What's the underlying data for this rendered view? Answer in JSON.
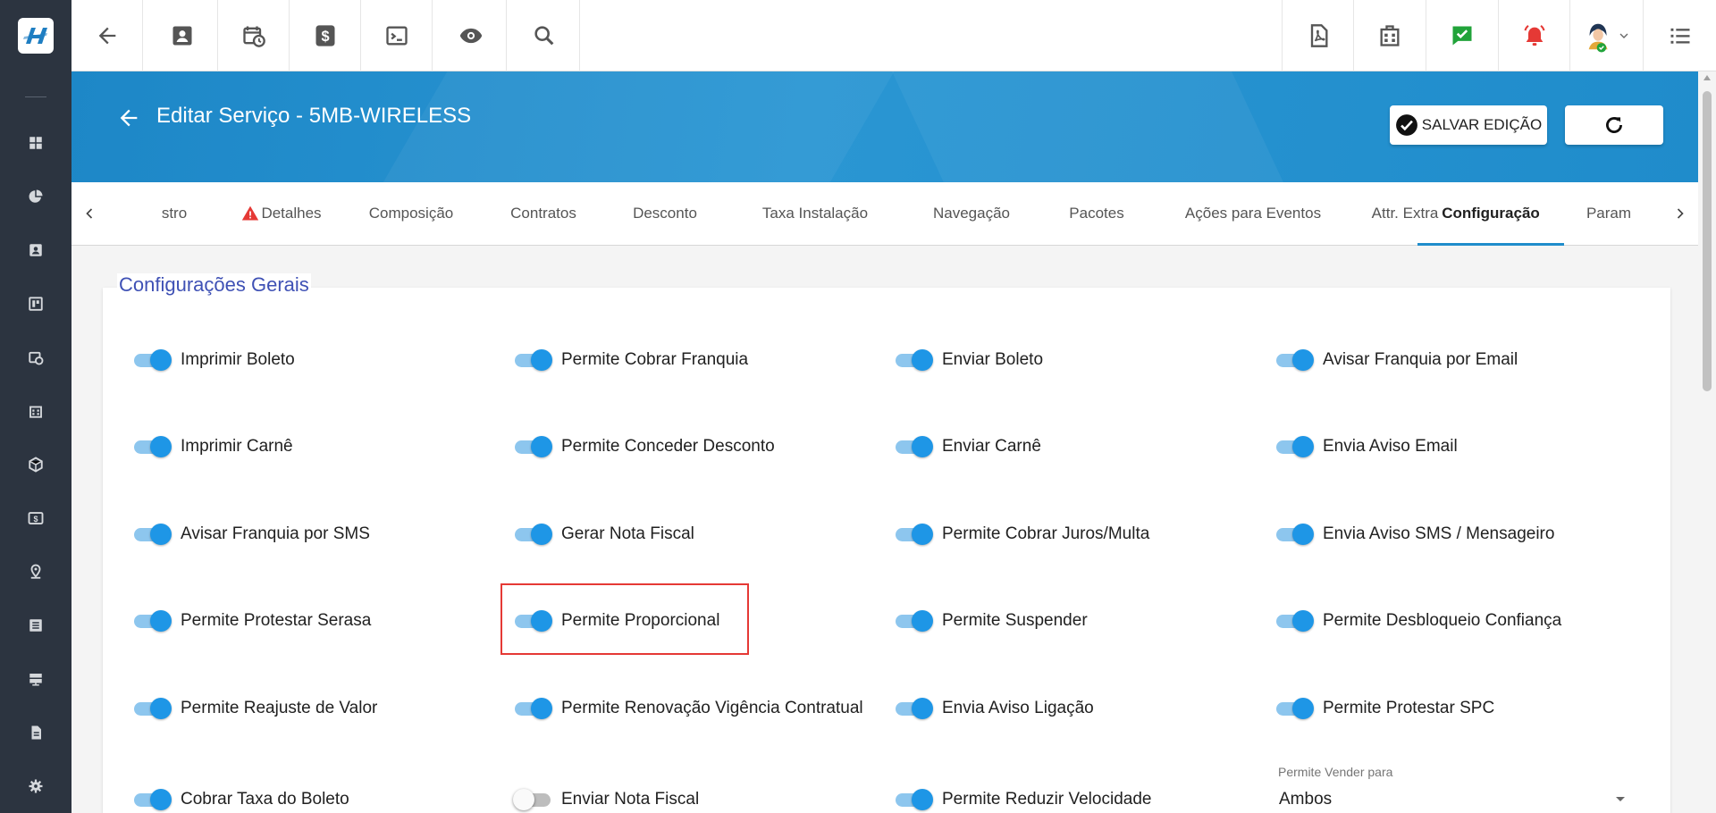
{
  "page": {
    "title": "Editar Serviço - 5MB-WIRELESS",
    "save_label": "SALVAR EDIÇÃO"
  },
  "colors": {
    "banner": "#1f8ccb",
    "sidebar": "#2c3440",
    "toggle_on": "#1e96e6",
    "section_title": "#3f51b5",
    "highlight": "#e53935",
    "notification_check": "#21a33a",
    "notification_alarm": "#e53935"
  },
  "topbar_icons": [
    "back-arrow-icon",
    "contact-card-icon",
    "calendar-clock-icon",
    "dollar-icon",
    "terminal-icon",
    "eye-icon",
    "search-icon",
    "pdf-icon",
    "building-icon",
    "check-message-icon",
    "alarm-icon",
    "user-avatar",
    "list-menu-icon"
  ],
  "sidebar_icons": [
    "dashboard-icon",
    "pie-chart-icon",
    "contact-icon",
    "board-icon",
    "calendar-icon",
    "building-icon",
    "package-icon",
    "dollar-icon",
    "location-icon",
    "list-icon",
    "server-icon",
    "document-icon",
    "settings-icon"
  ],
  "tabs": [
    {
      "label": "stro"
    },
    {
      "label": "Detalhes",
      "warning": true
    },
    {
      "label": "Composição"
    },
    {
      "label": "Contratos"
    },
    {
      "label": "Desconto"
    },
    {
      "label": "Taxa Instalação"
    },
    {
      "label": "Navegação"
    },
    {
      "label": "Pacotes"
    },
    {
      "label": "Ações para Eventos"
    },
    {
      "label": "Attr. Extra"
    },
    {
      "label": "Configuração",
      "active": true
    },
    {
      "label": "Param"
    }
  ],
  "section": {
    "title": "Configurações Gerais"
  },
  "switches": [
    [
      {
        "label": "Imprimir Boleto",
        "on": true
      },
      {
        "label": "Permite Cobrar Franquia",
        "on": true
      },
      {
        "label": "Enviar Boleto",
        "on": true
      },
      {
        "label": "Avisar Franquia por Email",
        "on": true
      }
    ],
    [
      {
        "label": "Imprimir Carnê",
        "on": true
      },
      {
        "label": "Permite Conceder Desconto",
        "on": true
      },
      {
        "label": "Enviar Carnê",
        "on": true
      },
      {
        "label": "Envia Aviso Email",
        "on": true
      }
    ],
    [
      {
        "label": "Avisar Franquia por SMS",
        "on": true
      },
      {
        "label": "Gerar Nota Fiscal",
        "on": true
      },
      {
        "label": "Permite Cobrar Juros/Multa",
        "on": true
      },
      {
        "label": "Envia Aviso SMS / Mensageiro",
        "on": true
      }
    ],
    [
      {
        "label": "Permite Protestar Serasa",
        "on": true
      },
      {
        "label": "Permite Proporcional",
        "on": true
      },
      {
        "label": "Permite Suspender",
        "on": true
      },
      {
        "label": "Permite Desbloqueio Confiança",
        "on": true
      }
    ],
    [
      {
        "label": "Permite Reajuste de Valor",
        "on": true
      },
      {
        "label": "Permite Renovação Vigência Contratual",
        "on": true
      },
      {
        "label": "Envia Aviso Ligação",
        "on": true
      },
      {
        "label": "Permite Protestar SPC",
        "on": true
      }
    ],
    [
      {
        "label": "Cobrar Taxa do Boleto",
        "on": true
      },
      {
        "label": "Enviar Nota Fiscal",
        "on": false
      },
      {
        "label": "Permite Reduzir Velocidade",
        "on": true
      }
    ]
  ],
  "vender_select": {
    "label": "Permite Vender para",
    "value": "Ambos"
  }
}
